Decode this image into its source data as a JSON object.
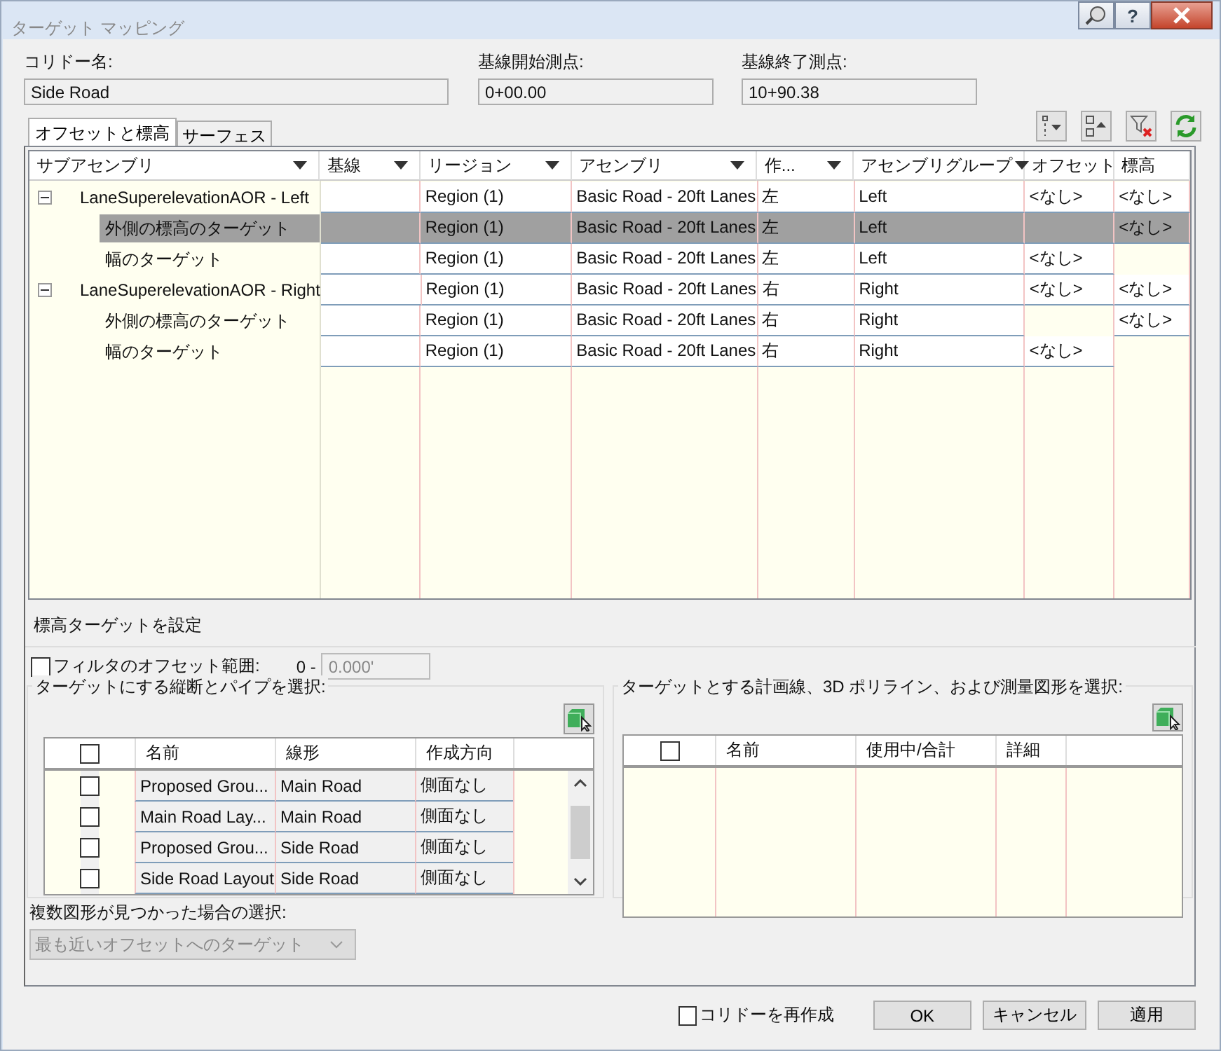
{
  "window": {
    "title": "ターゲット マッピング",
    "help": "?"
  },
  "fields": [
    {
      "label": "コリドー名:",
      "value": "Side Road"
    },
    {
      "label": "基線開始測点:",
      "value": "0+00.00"
    },
    {
      "label": "基線終了測点:",
      "value": "10+90.38"
    }
  ],
  "tabs": [
    {
      "label": "オフセットと標高",
      "selected": true
    },
    {
      "label": "サーフェス",
      "selected": false
    }
  ],
  "grid": {
    "columns": [
      {
        "label": "サブアセンブリ",
        "sortable": true
      },
      {
        "label": "基線",
        "sortable": true
      },
      {
        "label": "リージョン",
        "sortable": true
      },
      {
        "label": "アセンブリ",
        "sortable": true
      },
      {
        "label": "作...",
        "sortable": true
      },
      {
        "label": "アセンブリグループ",
        "sortable": true
      },
      {
        "label": "オフセット",
        "sortable": false
      },
      {
        "label": "標高",
        "sortable": false
      }
    ],
    "rows": [
      {
        "name": "LaneSuperelevationAOR - Left",
        "expanded": true,
        "selected": false,
        "region": "Region (1)",
        "assembly": "Basic Road - 20ft Lanes",
        "side": "左",
        "group": "Left",
        "offset": "<なし>",
        "elevation": "<なし>",
        "children": [
          {
            "name": "外側の標高のターゲット",
            "selected": true,
            "region": "Region (1)",
            "assembly": "Basic Road - 20ft Lanes",
            "side": "左",
            "group": "Left",
            "elevation": "<なし>"
          },
          {
            "name": "幅のターゲット",
            "selected": false,
            "region": "Region (1)",
            "assembly": "Basic Road - 20ft Lanes",
            "side": "左",
            "group": "Left",
            "offset": "<なし>"
          }
        ]
      },
      {
        "name": "LaneSuperelevationAOR - Right",
        "expanded": true,
        "selected": false,
        "region": "Region (1)",
        "assembly": "Basic Road - 20ft Lanes",
        "side": "右",
        "group": "Right",
        "offset": "<なし>",
        "elevation": "<なし>",
        "children": [
          {
            "name": "外側の標高のターゲット",
            "selected": false,
            "region": "Region (1)",
            "assembly": "Basic Road - 20ft Lanes",
            "side": "右",
            "group": "Right",
            "elevation": "<なし>"
          },
          {
            "name": "幅のターゲット",
            "selected": false,
            "region": "Region (1)",
            "assembly": "Basic Road - 20ft Lanes",
            "side": "右",
            "group": "Right",
            "offset": "<なし>"
          }
        ]
      }
    ]
  },
  "section_title": "標高ターゲットを設定",
  "filter": {
    "label": "フィルタのオフセット範囲:",
    "checked": false,
    "prefix": "0 -",
    "value": "0.000'",
    "disabled": true
  },
  "profiles": {
    "title": "ターゲットにする縦断とパイプを選択:",
    "header_checked": false,
    "columns": [
      "名前",
      "線形",
      "作成方向"
    ],
    "rows": [
      {
        "checked": false,
        "name": "Proposed Grou...",
        "alignment": "Main Road",
        "direction": "側面なし"
      },
      {
        "checked": false,
        "name": "Main Road Lay...",
        "alignment": "Main Road",
        "direction": "側面なし"
      },
      {
        "checked": false,
        "name": "Proposed Grou...",
        "alignment": "Side Road",
        "direction": "側面なし"
      },
      {
        "checked": false,
        "name": "Side Road Layout",
        "alignment": "Side Road",
        "direction": "側面なし"
      }
    ]
  },
  "features": {
    "title": "ターゲットとする計画線、3D ポリライン、および測量図形を選択:",
    "header_checked": false,
    "columns": [
      "名前",
      "使用中/合計",
      "詳細"
    ]
  },
  "multiple": {
    "label": "複数図形が見つかった場合の選択:",
    "value": "最も近いオフセットへのターゲット",
    "disabled": true
  },
  "footer": {
    "recreate": {
      "label": "コリドーを再作成",
      "checked": false
    },
    "buttons": [
      "OK",
      "キャンセル",
      "適用"
    ]
  }
}
